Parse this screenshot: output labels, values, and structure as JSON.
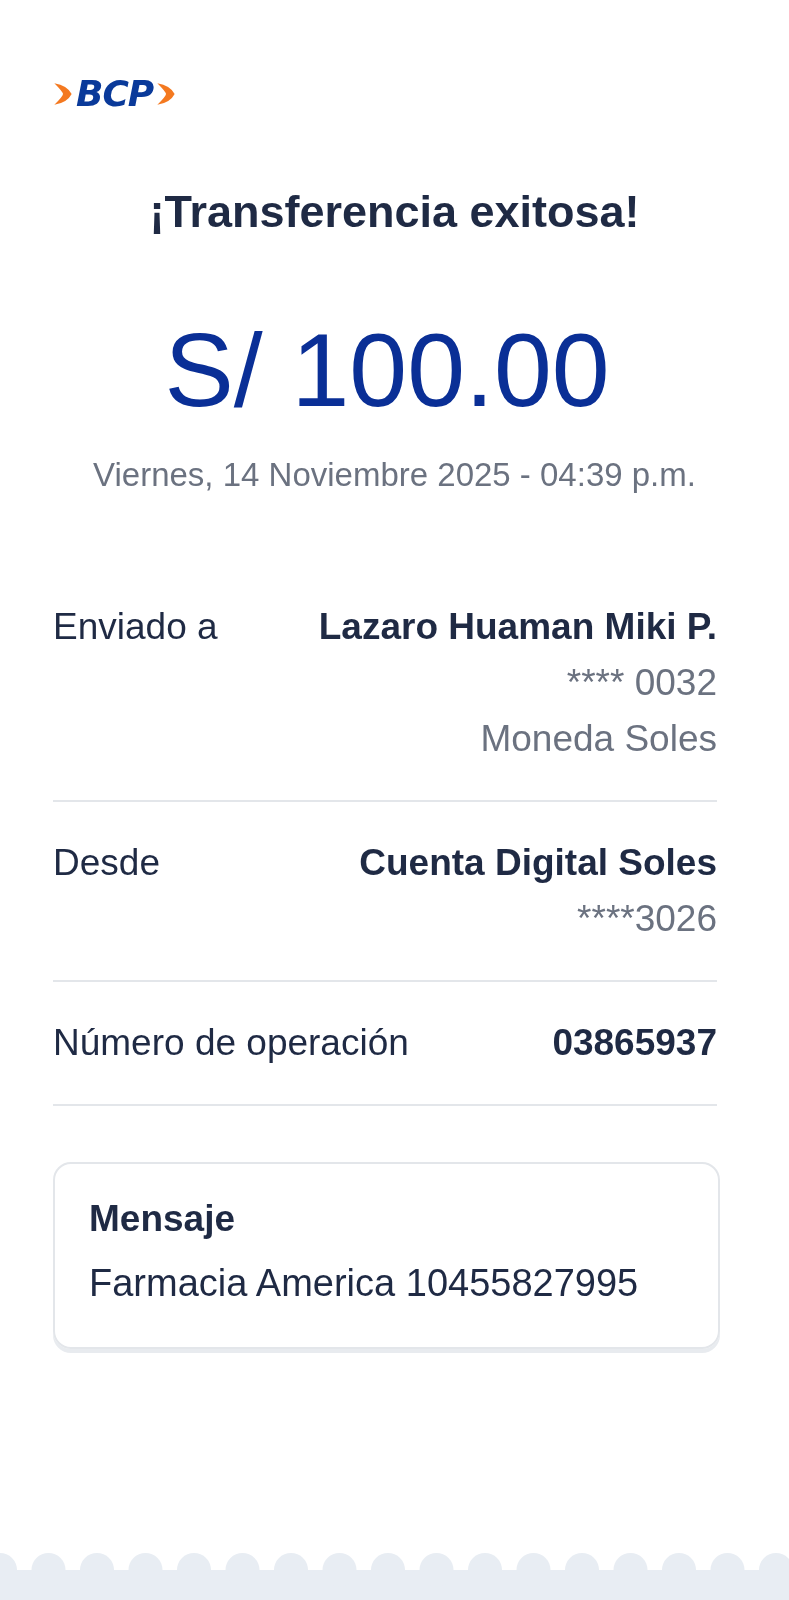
{
  "logo": {
    "text": "BCP"
  },
  "title": "¡Transferencia exitosa!",
  "amount": "S/ 100.00",
  "datetime": "Viernes, 14 Noviembre 2025 - 04:39 p.m.",
  "details": [
    {
      "label": "Enviado a",
      "values": [
        {
          "text": "Lazaro Huaman Miki P.",
          "bold": true
        },
        {
          "text": "**** 0032",
          "bold": false
        },
        {
          "text": "Moneda Soles",
          "bold": false
        }
      ]
    },
    {
      "label": "Desde",
      "values": [
        {
          "text": "Cuenta Digital Soles",
          "bold": true
        },
        {
          "text": "****3026",
          "bold": false
        }
      ]
    },
    {
      "label": "Número de operación",
      "values": [
        {
          "text": "03865937",
          "bold": true
        }
      ]
    }
  ],
  "message": {
    "heading": "Mensaje",
    "text": "Farmacia America 10455827995"
  }
}
